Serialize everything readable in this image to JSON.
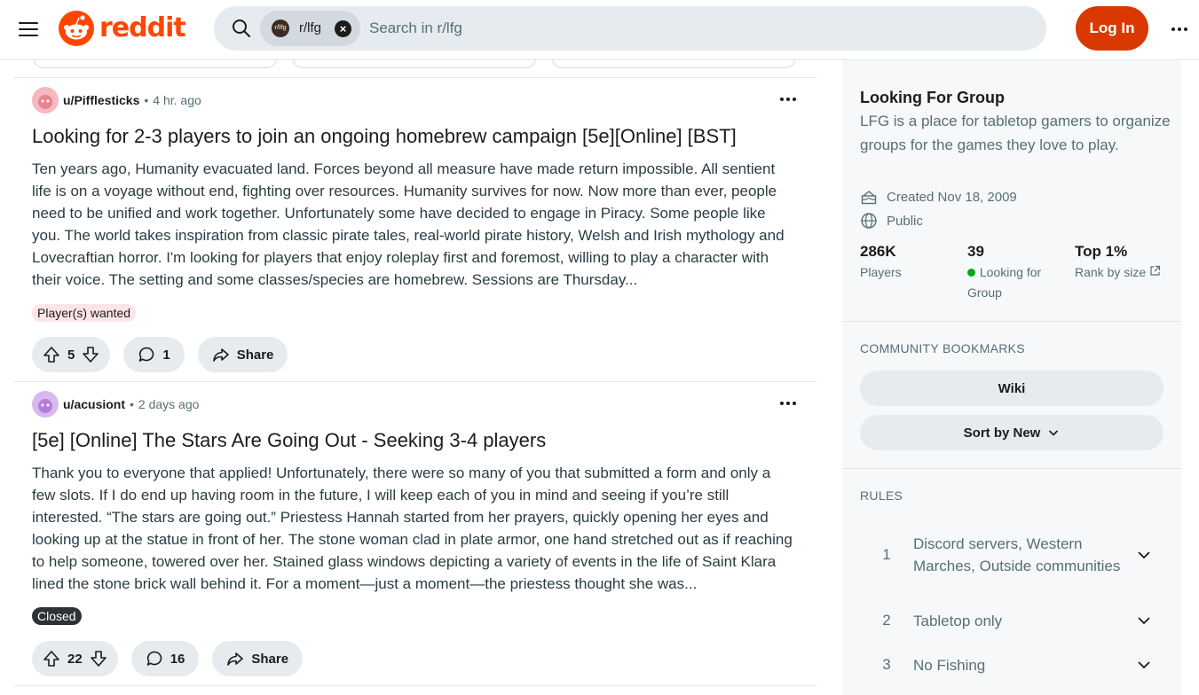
{
  "header": {
    "logo_text": "reddit",
    "search_chip_label": "r/lfg",
    "search_chip_avatar_text": "r/lfg",
    "search_placeholder": "Search in r/lfg",
    "login_label": "Log In"
  },
  "feed": {
    "posts": [
      {
        "author": "u/Pifflesticks",
        "time": "4 hr. ago",
        "title": "Looking for 2-3 players to join an ongoing homebrew campaign [5e][Online] [BST]",
        "body": "Ten years ago, Humanity evacuated land. Forces beyond all measure have made return impossible. All sentient life is on a voyage without end, fighting over resources. Humanity survives for now. Now more than ever, people need to be unified and work together. Unfortunately some have decided to engage in Piracy. Some people like you. The world takes inspiration from classic pirate tales, real-world pirate history, Welsh and Irish mythology and Lovecraftian horror. I'm looking for players that enjoy roleplay first and foremost, willing to play a character with their voice. The setting and some classes/species are homebrew. Sessions are Thursday...",
        "flair": "Player(s) wanted",
        "flair_bg": "#fde4e6",
        "flair_color": "#1c1c1c",
        "votes": "5",
        "comments": "1",
        "share_label": "Share"
      },
      {
        "author": "u/acusiont",
        "time": "2 days ago",
        "title": "[5e] [Online] The Stars Are Going Out - Seeking 3-4 players",
        "body": "Thank you to everyone that applied! Unfortunately, there were so many of you that submitted a form and only a few slots. If I do end up having room in the future, I will keep each of you in mind and seeing if you’re still interested. “The stars are going out.” Priestess Hannah started from her prayers, quickly opening her eyes and looking up at the statue in front of her. The stone woman clad in plate armor, one hand stretched out as if reaching to help someone, towered over her. Stained glass windows depicting a variety of events in the life of Saint Klara lined the stone brick wall behind it. For a moment—just a moment—the priestess thought she was...",
        "flair": "Closed",
        "flair_bg": "#2e3236",
        "flair_color": "#ffffff",
        "votes": "22",
        "comments": "16",
        "share_label": "Share"
      }
    ]
  },
  "sidebar": {
    "title": "Looking For Group",
    "description": "LFG is a place for tabletop gamers to organize groups for the games they love to play.",
    "created": "Created Nov 18, 2009",
    "visibility": "Public",
    "stats": [
      {
        "value": "286K",
        "label": "Players"
      },
      {
        "value": "39",
        "label": "Looking for Group"
      },
      {
        "value": "Top 1%",
        "label": "Rank by size"
      }
    ],
    "bookmarks_heading": "COMMUNITY BOOKMARKS",
    "bookmarks": [
      "Wiki",
      "Sort by New"
    ],
    "rules_heading": "RULES",
    "rules": [
      {
        "num": "1",
        "text": "Discord servers, Western Marches, Outside communities"
      },
      {
        "num": "2",
        "text": "Tabletop only"
      },
      {
        "num": "3",
        "text": "No Fishing"
      }
    ]
  },
  "colors": {
    "brand": "#ff4500",
    "login_bg": "#d93900",
    "online_dot": "#01a816"
  }
}
